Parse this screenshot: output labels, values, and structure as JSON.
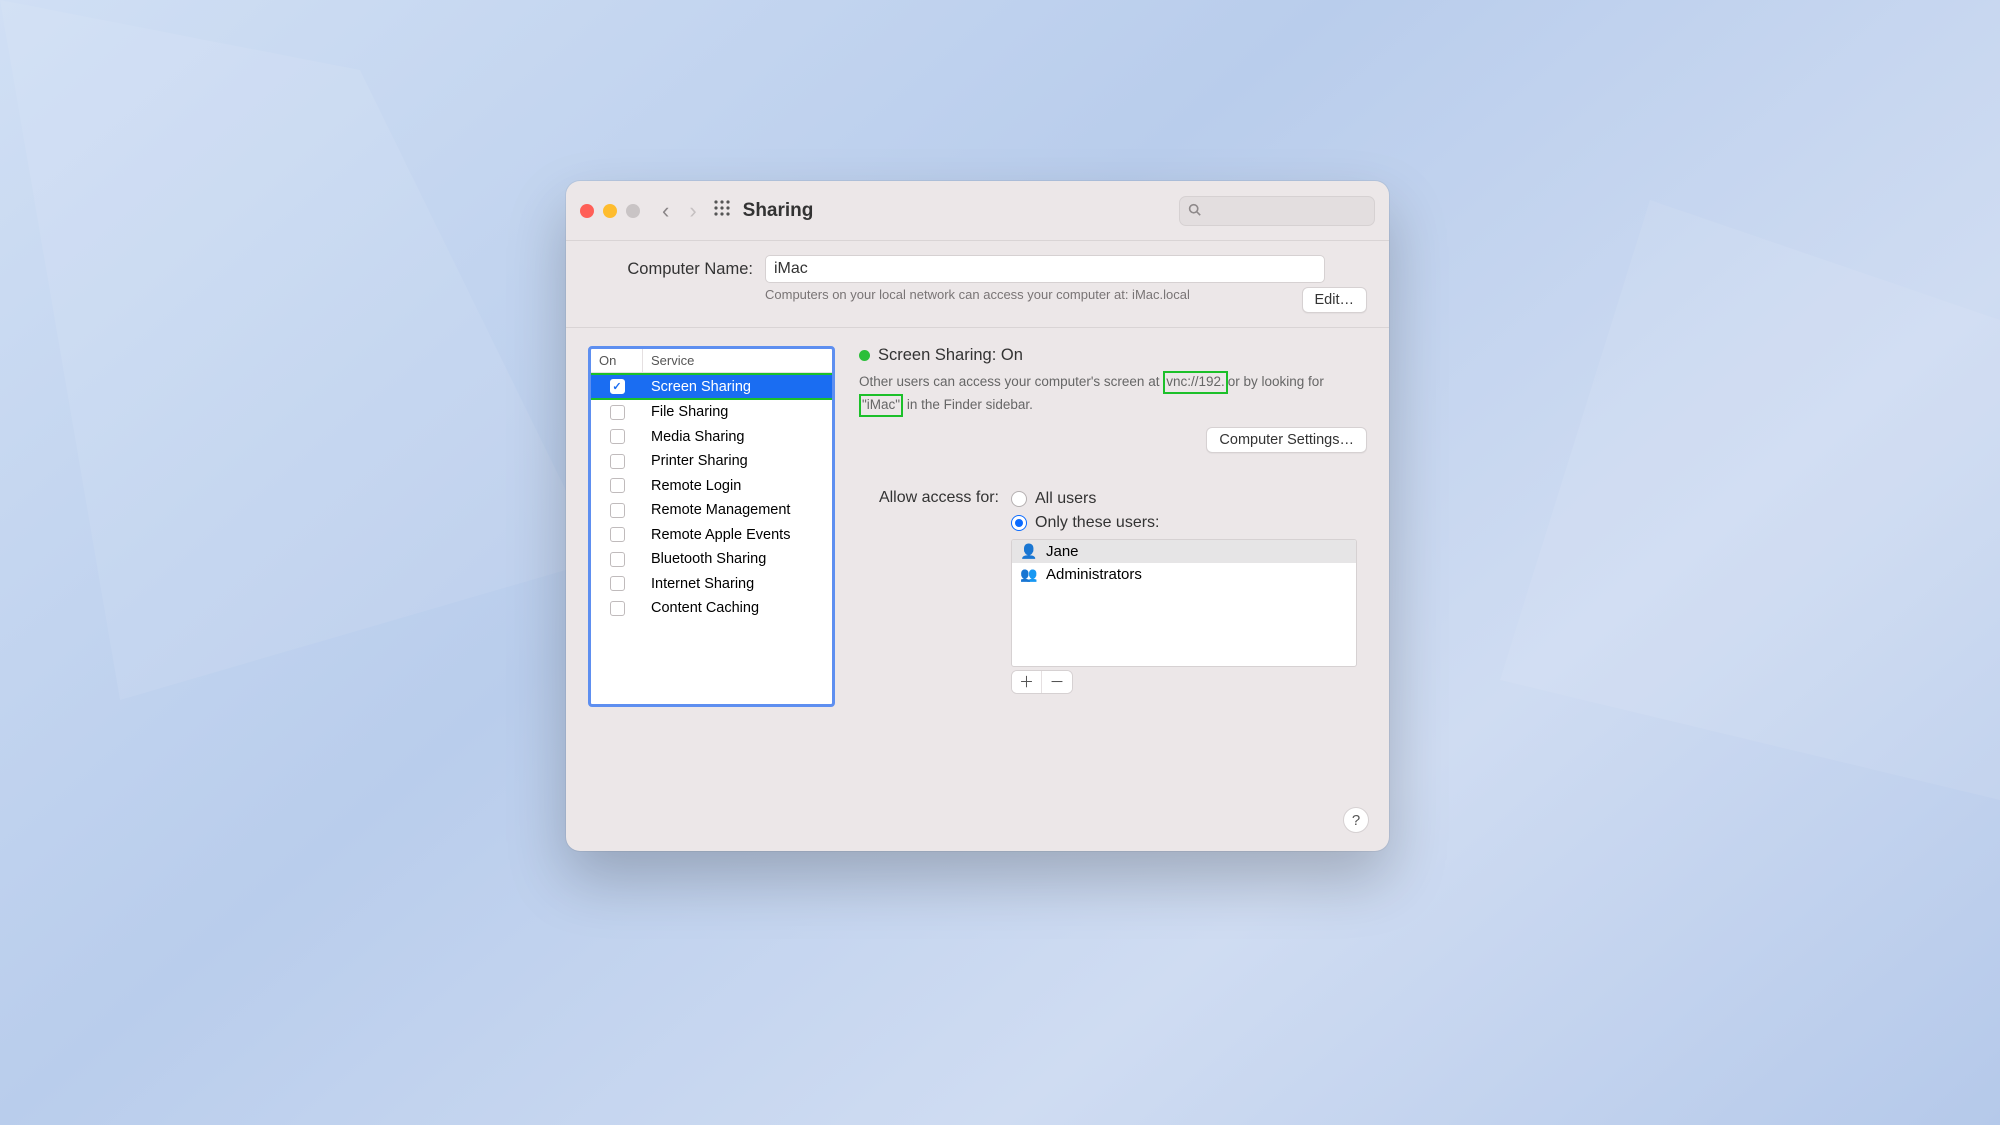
{
  "window": {
    "title": "Sharing"
  },
  "search": {
    "placeholder": ""
  },
  "computer_name": {
    "label": "Computer Name:",
    "value": "iMac",
    "subtext": "Computers on your local network can access your computer at: iMac.local",
    "edit_label": "Edit…"
  },
  "services": {
    "header_on": "On",
    "header_service": "Service",
    "items": [
      {
        "label": "Screen Sharing",
        "checked": true,
        "selected": true
      },
      {
        "label": "File Sharing",
        "checked": false,
        "selected": false
      },
      {
        "label": "Media Sharing",
        "checked": false,
        "selected": false
      },
      {
        "label": "Printer Sharing",
        "checked": false,
        "selected": false
      },
      {
        "label": "Remote Login",
        "checked": false,
        "selected": false
      },
      {
        "label": "Remote Management",
        "checked": false,
        "selected": false
      },
      {
        "label": "Remote Apple Events",
        "checked": false,
        "selected": false
      },
      {
        "label": "Bluetooth Sharing",
        "checked": false,
        "selected": false
      },
      {
        "label": "Internet Sharing",
        "checked": false,
        "selected": false
      },
      {
        "label": "Content Caching",
        "checked": false,
        "selected": false
      }
    ]
  },
  "status": {
    "title": "Screen Sharing: On",
    "desc_pre": "Other users can access your computer's screen at ",
    "highlight1": "vnc://192.",
    "desc_mid": "or by looking for ",
    "highlight2": "\"iMac\"",
    "desc_post": " in the Finder sidebar.",
    "settings_label": "Computer Settings…"
  },
  "access": {
    "label": "Allow access for:",
    "option_all": "All users",
    "option_only": "Only these users:",
    "selected": "only",
    "users": [
      {
        "name": "Jane",
        "icon": "person",
        "selected": true
      },
      {
        "name": "Administrators",
        "icon": "group",
        "selected": false
      }
    ]
  },
  "help": {
    "label": "?"
  }
}
